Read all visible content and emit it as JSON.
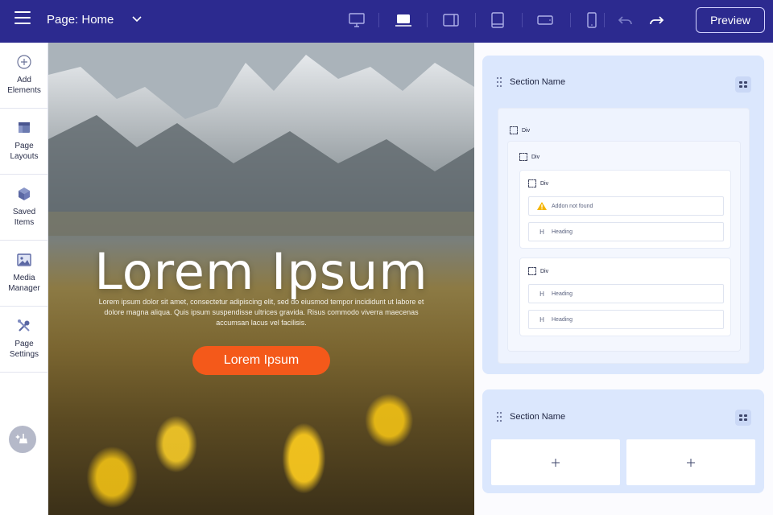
{
  "topbar": {
    "page_title": "Page: Home",
    "preview_label": "Preview",
    "devices": [
      "desktop-icon",
      "laptop-icon",
      "tablet-landscape-icon",
      "tablet-portrait-icon",
      "mobile-landscape-icon",
      "mobile-portrait-icon"
    ],
    "active_device": "laptop-icon"
  },
  "sidebar": {
    "items": [
      {
        "label": "Add\nElements",
        "icon": "add-circle-icon"
      },
      {
        "label": "Page\nLayouts",
        "icon": "layout-icon"
      },
      {
        "label": "Saved\nItems",
        "icon": "cube-icon"
      },
      {
        "label": "Media\nManager",
        "icon": "image-icon"
      },
      {
        "label": "Page\nSettings",
        "icon": "tools-icon"
      }
    ]
  },
  "hero": {
    "title": "Lorem Ipsum",
    "text": "Lorem ipsum dolor sit amet, consectetur adipiscing elit, sed do eiusmod tempor incididunt ut labore et dolore magna aliqua. Quis ipsum suspendisse ultrices gravida. Risus commodo viverra maecenas accumsan lacus vel facilisis.",
    "button_label": "Lorem Ipsum"
  },
  "structure": {
    "section1": {
      "name": "Section Name",
      "div_outer": "Div",
      "div_inner": "Div",
      "div_a": "Div",
      "div_a_items": [
        "Addon not found",
        "Heading"
      ],
      "div_b": "Div",
      "div_b_items": [
        "Heading",
        "Heading"
      ]
    },
    "section2": {
      "name": "Section Name"
    }
  },
  "colors": {
    "topbar": "#2c2a8f",
    "accent_button": "#f4591a",
    "section_bg": "#dbe7fd",
    "warning": "#f5b400"
  }
}
